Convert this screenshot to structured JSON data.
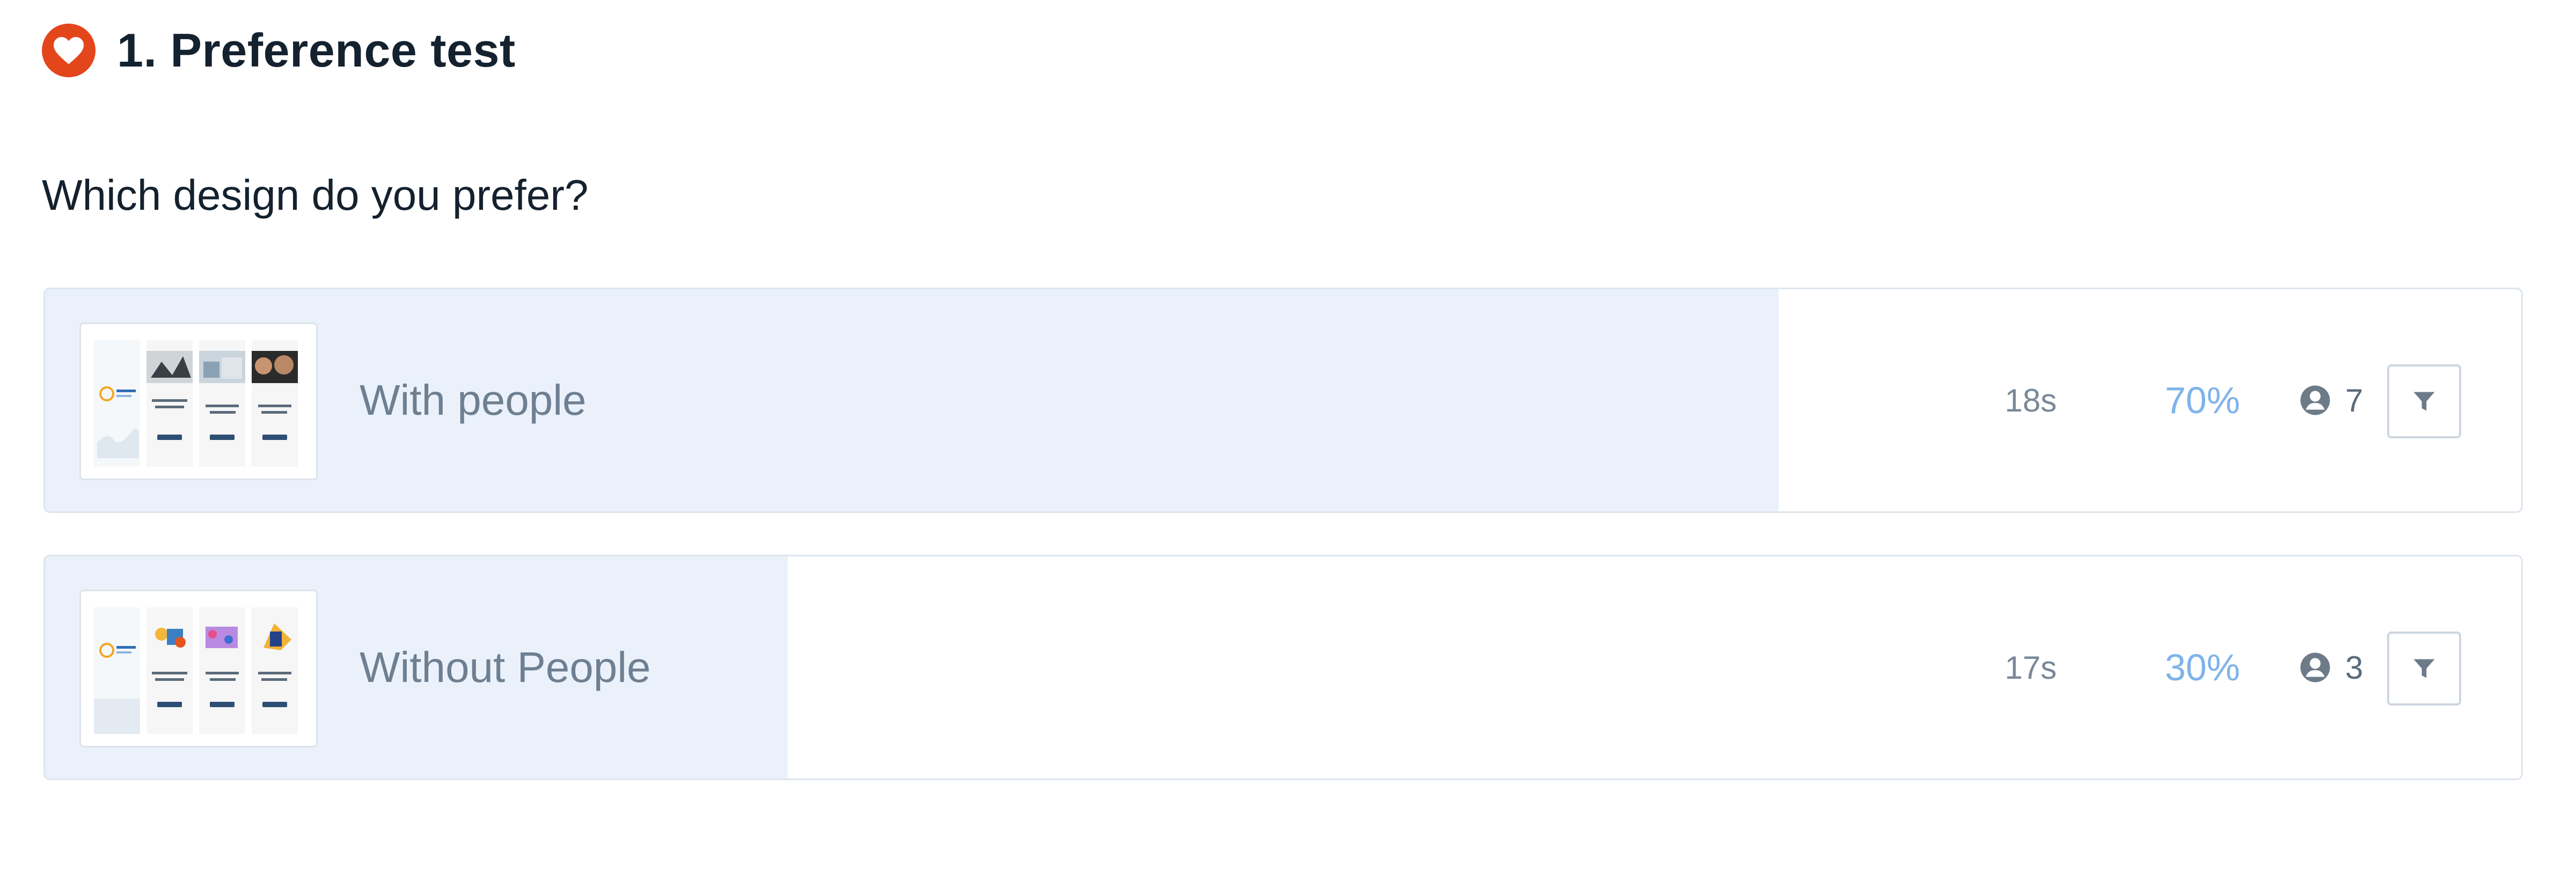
{
  "header": {
    "title": "1. Preference test",
    "badge_icon": "heart-icon",
    "badge_color": "#e4461c"
  },
  "question": "Which design do you prefer?",
  "options": [
    {
      "label": "With people",
      "time": "18s",
      "percent": "70%",
      "share": 0.7,
      "respondents": "7",
      "thumbnail_icon": "design-thumbnail",
      "filter_icon": "filter-icon"
    },
    {
      "label": "Without People",
      "time": "17s",
      "percent": "30%",
      "share": 0.3,
      "respondents": "3",
      "thumbnail_icon": "design-thumbnail",
      "filter_icon": "filter-icon"
    }
  ],
  "colors": {
    "bar_fill": "#eaf1fa",
    "percent": "#7fb3ea",
    "border": "#dde5ee"
  }
}
